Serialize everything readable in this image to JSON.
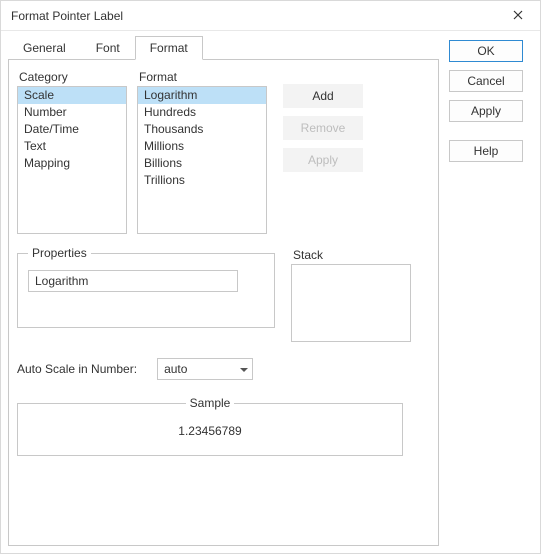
{
  "window": {
    "title": "Format Pointer Label"
  },
  "tabs": {
    "general": "General",
    "font": "Font",
    "format": "Format"
  },
  "labels": {
    "category": "Category",
    "format": "Format",
    "properties": "Properties",
    "stack": "Stack",
    "autoScale": "Auto Scale in Number:",
    "sample": "Sample"
  },
  "category": {
    "items": [
      "Scale",
      "Number",
      "Date/Time",
      "Text",
      "Mapping"
    ],
    "selectedIndex": 0
  },
  "formatList": {
    "items": [
      "Logarithm",
      "Hundreds",
      "Thousands",
      "Millions",
      "Billions",
      "Trillions"
    ],
    "selectedIndex": 0
  },
  "actions": {
    "add": "Add",
    "remove": "Remove",
    "apply": "Apply"
  },
  "properties": {
    "value": "Logarithm"
  },
  "autoScale": {
    "value": "auto"
  },
  "sample": {
    "value": "1.23456789"
  },
  "dialogButtons": {
    "ok": "OK",
    "cancel": "Cancel",
    "apply": "Apply",
    "help": "Help"
  }
}
